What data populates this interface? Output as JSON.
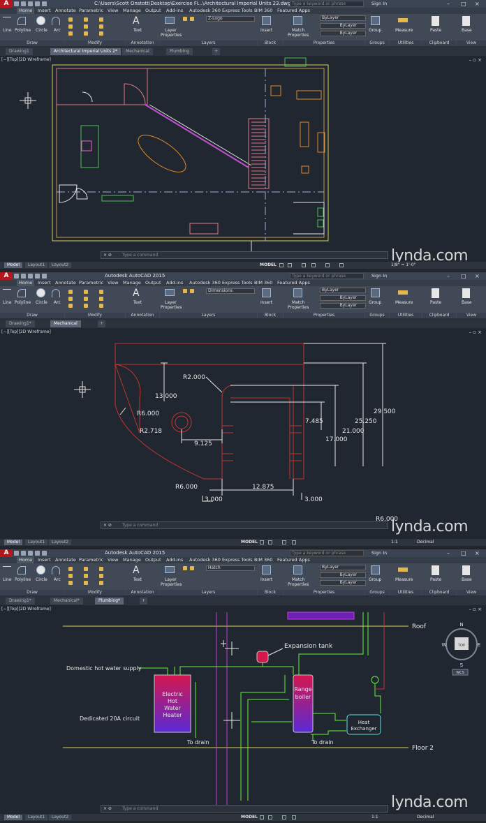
{
  "lynda_mark": "lynda.com",
  "ribbon_tabs": [
    "Home",
    "Insert",
    "Annotate",
    "Parametric",
    "View",
    "Manage",
    "Output",
    "Add-ins",
    "Autodesk 360",
    "Express Tools",
    "BIM 360",
    "Featured Apps"
  ],
  "ribbon": {
    "line": "Line",
    "polyline": "Polyline",
    "circle": "Circle",
    "arc": "Arc",
    "text": "Text",
    "layer_properties_1": "Layer",
    "layer_properties_2": "Properties",
    "insert": "Insert",
    "match_1": "Match",
    "match_2": "Properties",
    "group": "Group",
    "measure": "Measure",
    "paste": "Paste",
    "base": "Base",
    "bylayer": "ByLayer",
    "groups": [
      "Draw",
      "Modify",
      "Annotation",
      "Layers",
      "Block",
      "Properties",
      "Groups",
      "Utilities",
      "Clipboard",
      "View"
    ]
  },
  "search_placeholder": "Type a keyword or phrase",
  "sign_in": "Sign In",
  "viewport_label": "[−][Top][2D Wireframe]",
  "command_placeholder": "Type a command",
  "status": {
    "model": "MODEL",
    "layouts": [
      "Model",
      "Layout1",
      "Layout2"
    ],
    "scale_top": "1/8\" = 1'-0\"",
    "scale": "1:1",
    "units": "Decimal"
  },
  "panel1": {
    "window_title": "C:\\Users\\Scott Onstott\\Desktop\\Exercise Fi...\\Architectural Imperial Units 23.dwg",
    "layer": "Z-Logo",
    "file_tabs": [
      "Drawing1",
      "Architectural Imperial Units 2*",
      "Mechanical",
      "Plumbing"
    ]
  },
  "panel2": {
    "window_title": "Autodesk AutoCAD 2015",
    "layer": "Dimensions",
    "file_tabs": [
      "Drawing1*",
      "Mechanical"
    ],
    "dims": {
      "r2": "R2.000",
      "d13": "13.000",
      "r6a": "R6.000",
      "r2718": "R2.718",
      "d9125": "9.125",
      "d7485": "7.485",
      "d17": "17.000",
      "d21": "21.000",
      "d2525": "25.250",
      "d295": "29.500",
      "r6b": "R6.000",
      "d12875": "12.875",
      "d3a": "3.000",
      "d3b": "3.000",
      "r6c": "R6.000"
    }
  },
  "panel3": {
    "window_title": "Autodesk AutoCAD 2015",
    "layer": "Hatch",
    "file_tabs": [
      "Drawing1*",
      "Mechanical*",
      "Plumbing*"
    ],
    "labels": {
      "roof": "Roof",
      "expansion": "Expansion tank",
      "domestic": "Domestic hot water supply",
      "heater": [
        "Electric",
        "Hot",
        "Water",
        "Heater"
      ],
      "boiler": [
        "Range",
        "boiler"
      ],
      "exchanger": [
        "Heat",
        "Exchanger"
      ],
      "circuit": "Dedicated 20A circuit",
      "drain1": "To drain",
      "drain2": "To drain",
      "floor2": "Floor 2"
    },
    "viewcube": {
      "n": "N",
      "s": "S",
      "e": "E",
      "w": "W",
      "top": "TOP",
      "wcs": "WCS"
    }
  },
  "colors": {
    "accent": "#b5161b",
    "ribbon": "#414957",
    "canvas": "#212730",
    "green": "#63f03c",
    "magenta": "#c43fd8",
    "red_dim": "#c0342f"
  }
}
